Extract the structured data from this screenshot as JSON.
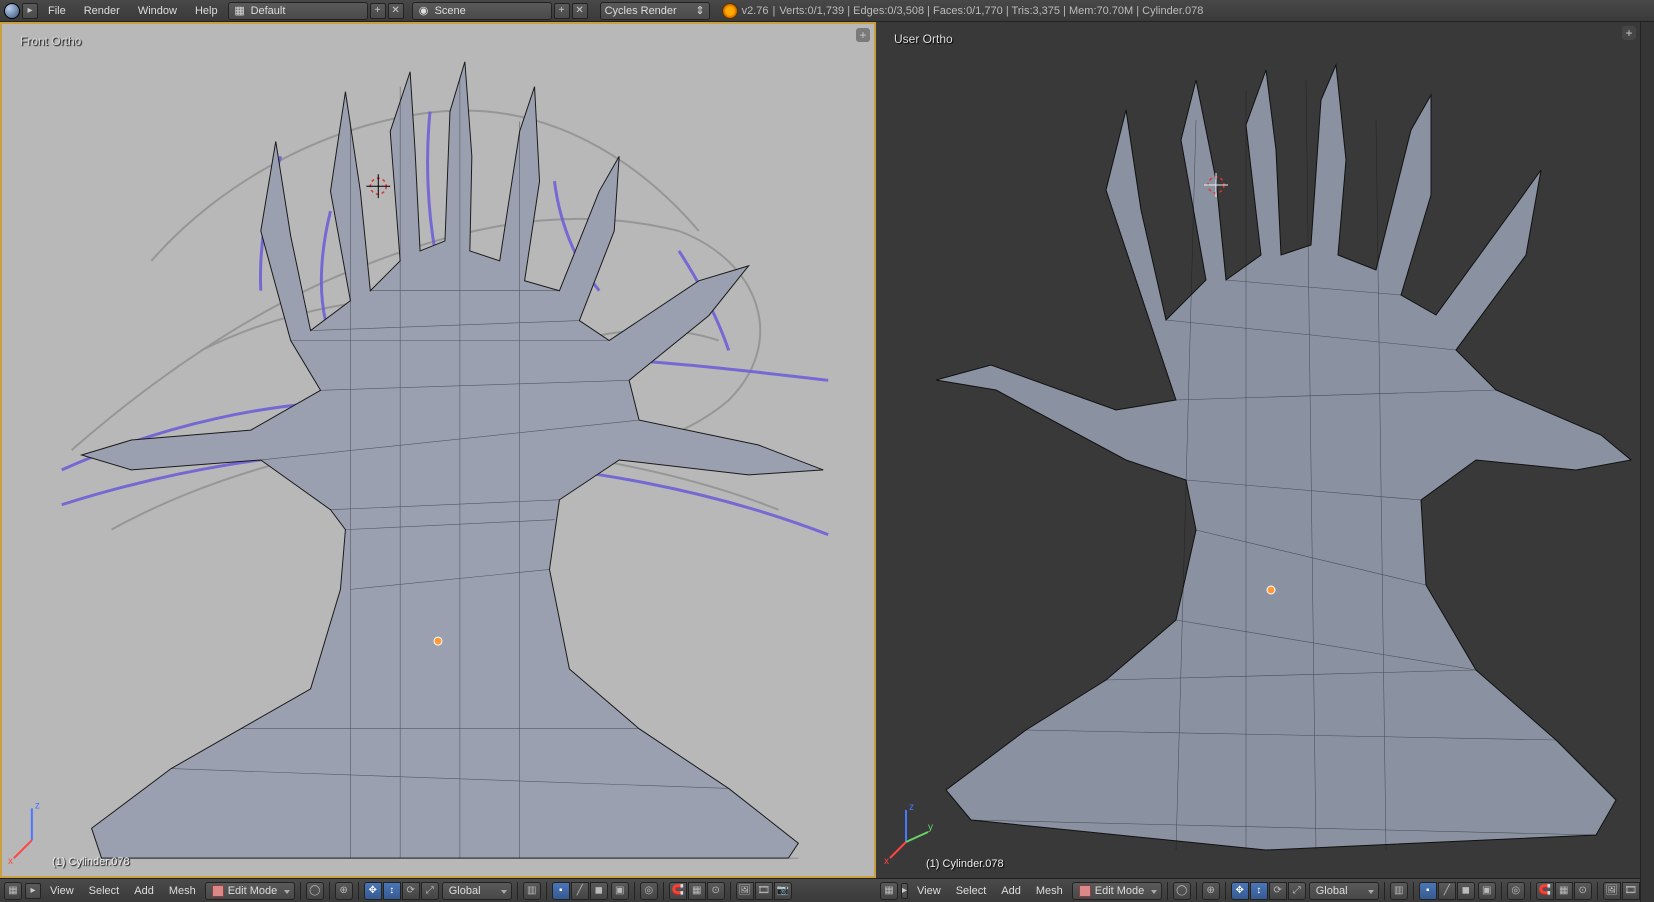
{
  "topbar": {
    "menus": [
      "File",
      "Render",
      "Window",
      "Help"
    ],
    "layout_field": "Default",
    "scene_field": "Scene",
    "renderer_field": "Cycles Render",
    "version": "v2.76",
    "stats": "Verts:0/1,739 | Edges:0/3,508 | Faces:0/1,770 | Tris:3,375 | Mem:70.70M | Cylinder.078"
  },
  "viewports": {
    "left": {
      "label": "Front Ortho",
      "object_name": "(1) Cylinder.078"
    },
    "right": {
      "label": "User Ortho",
      "object_name": "(1) Cylinder.078"
    }
  },
  "vp_header": {
    "menus": [
      "View",
      "Select",
      "Add",
      "Mesh"
    ],
    "mode": "Edit Mode",
    "orientation": "Global"
  }
}
